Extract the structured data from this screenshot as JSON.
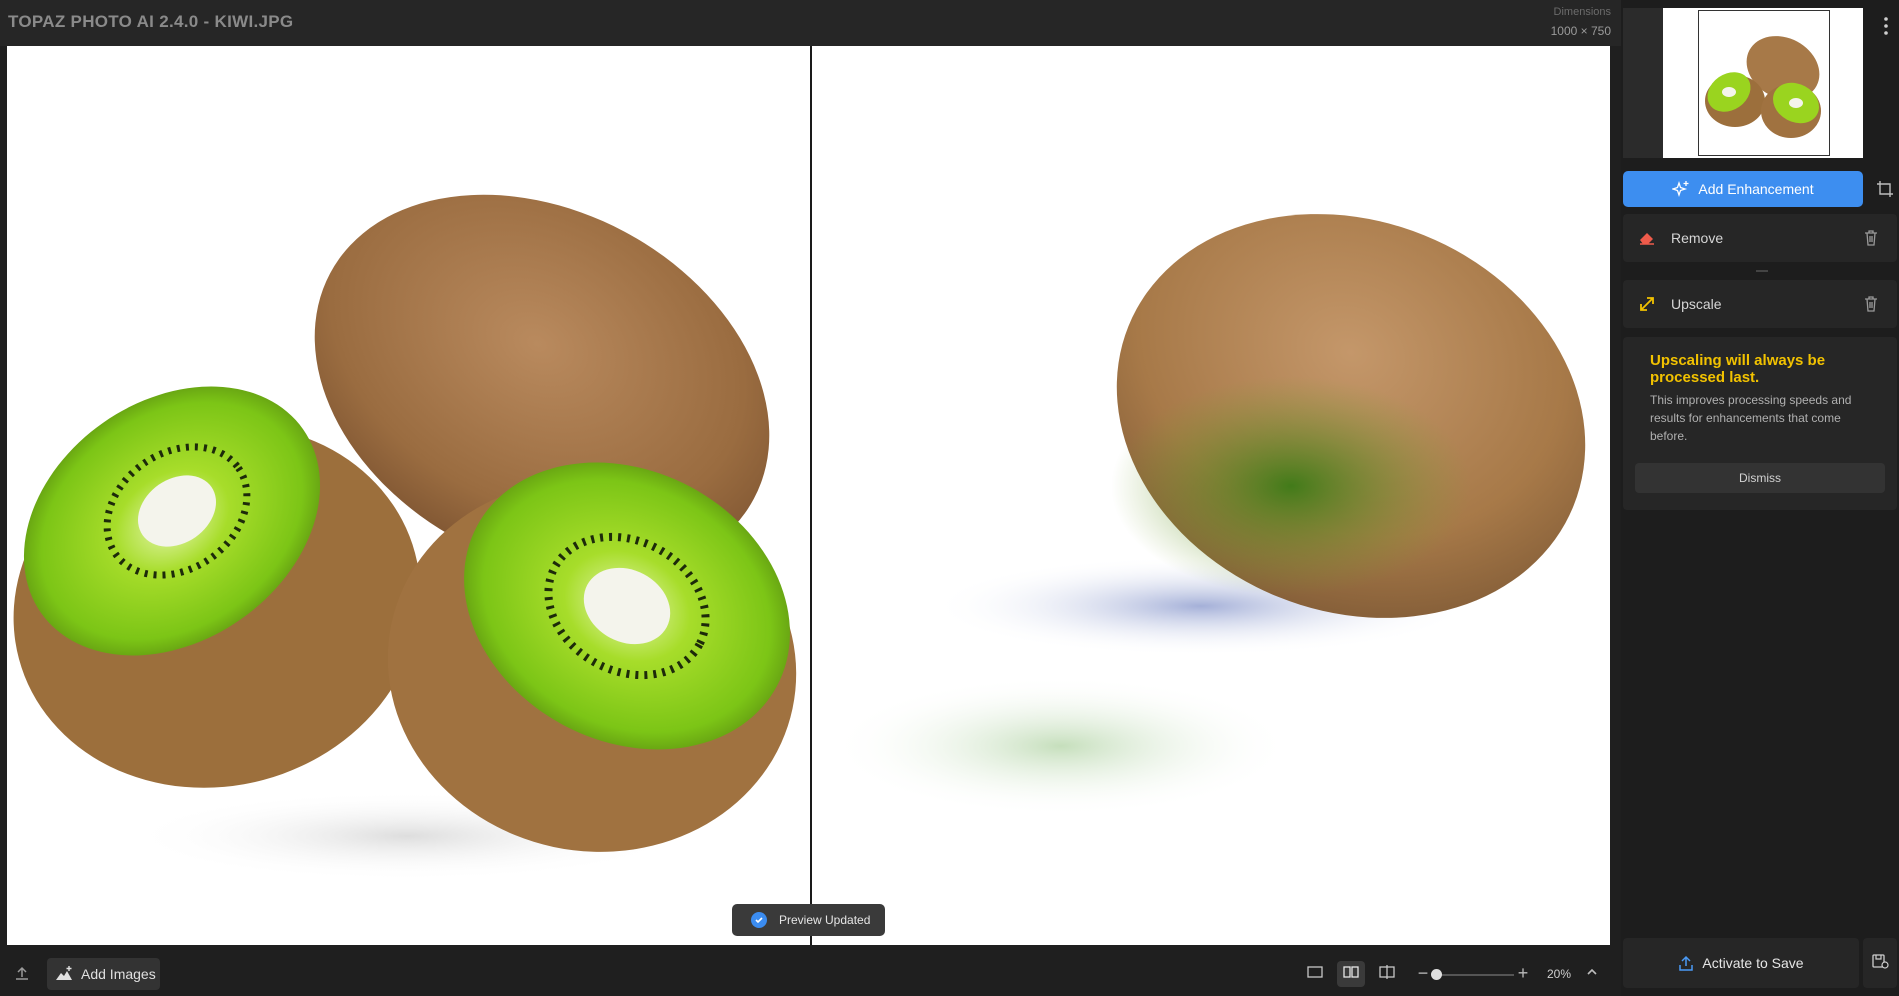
{
  "window": {
    "title": "TOPAZ PHOTO AI 2.4.0 - KIWI.JPG",
    "dimensions_label": "Dimensions",
    "dimensions_value": "1000 × 750"
  },
  "preview": {
    "toast_text": "Preview Updated"
  },
  "bottombar": {
    "add_images_label": "Add Images",
    "zoom_value": "20%",
    "zoom_minus": "−",
    "zoom_plus": "+"
  },
  "sidebar": {
    "add_enhancement_label": "Add Enhancement",
    "enhancements": [
      {
        "label": "Remove"
      },
      {
        "label": "Upscale"
      }
    ],
    "note": {
      "title": "Upscaling will always be processed last.",
      "body": "This improves processing speeds and results for enhancements that come before.",
      "dismiss_label": "Dismiss"
    },
    "activate_label": "Activate to Save"
  },
  "colors": {
    "accent": "#3d8ef0",
    "warning_text": "#f2c200",
    "remove_icon": "#ef5b4b",
    "upscale_icon": "#f2c200"
  },
  "icons": {
    "upload": "upload-icon",
    "add_images": "mountain-plus-icon",
    "view_single": "single-view-icon",
    "view_split": "split-view-icon",
    "view_side": "side-by-side-icon",
    "chevron": "chevron-up-icon",
    "more": "more-vertical-icon",
    "add_enhancement": "sparkle-plus-icon",
    "crop": "crop-icon",
    "remove": "eraser-icon",
    "upscale": "expand-arrows-icon",
    "trash": "trash-icon",
    "activate": "upload-icon",
    "save_options": "save-settings-icon",
    "toast": "check-circle-icon"
  }
}
